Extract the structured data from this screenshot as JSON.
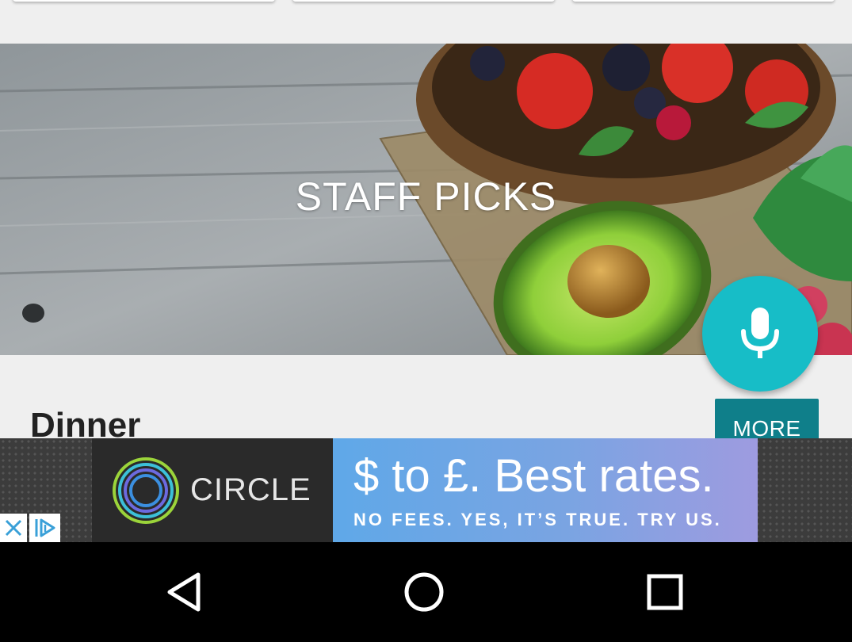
{
  "banner": {
    "title": "STAFF PICKS"
  },
  "fab": {
    "icon": "microphone-icon",
    "color": "#17bdc7"
  },
  "section": {
    "title": "Dinner",
    "more_label": "MORE",
    "more_color": "#0f7f8a"
  },
  "ad": {
    "brand": "CIRCLE",
    "headline": "$ to £. Best rates.",
    "subline": "NO FEES. YES, IT’S TRUE. TRY US.",
    "close_icon": "close-icon",
    "adchoices_icon": "adchoices-icon"
  },
  "navbar": {
    "back_icon": "back-triangle-icon",
    "home_icon": "home-circle-icon",
    "recents_icon": "recents-square-icon"
  }
}
